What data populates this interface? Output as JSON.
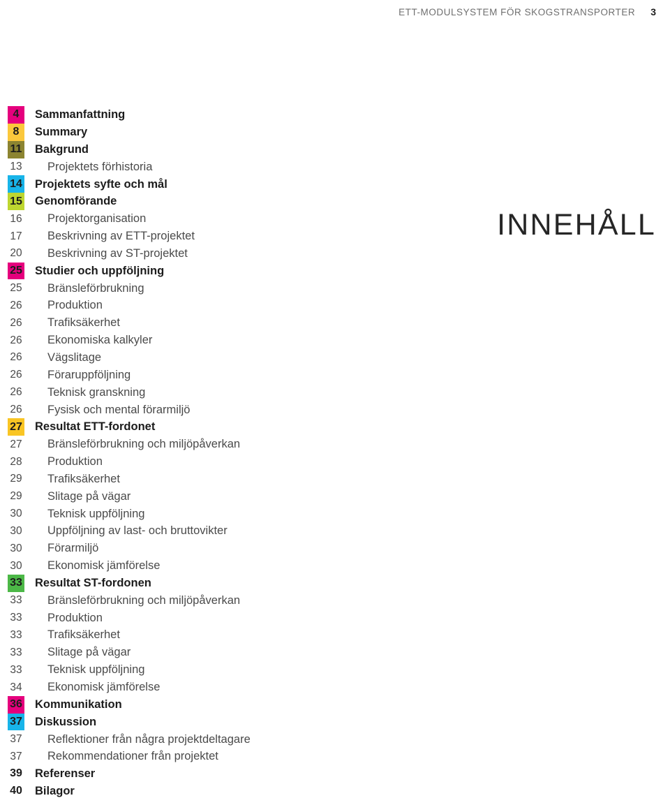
{
  "header": {
    "title": "ETT-MODULSYSTEM FÖR SKOGSTRANSPORTER",
    "folio": "3"
  },
  "section": {
    "title": "INNEHÅLL"
  },
  "colors": {
    "magenta": "#e5007d",
    "yellow": "#fbc83c",
    "olive": "#8c8431",
    "cyan": "#18b4e9",
    "lime": "#bed630",
    "gold": "#f9c524",
    "green": "#4cb847",
    "text_dark": "#1c1c1c",
    "text_gray": "#4a4a4a",
    "header_gray": "#6f6f6f"
  },
  "toc": {
    "items": [
      {
        "num": "4",
        "label": "Sammanfattning",
        "level": 1,
        "badge": "#e5007d"
      },
      {
        "num": "8",
        "label": "Summary",
        "level": 1,
        "badge": "#fbc83c"
      },
      {
        "num": "11",
        "label": "Bakgrund",
        "level": 1,
        "badge": "#8c8431"
      },
      {
        "num": "13",
        "label": "Projektets förhistoria",
        "level": 2,
        "badge": null
      },
      {
        "num": "14",
        "label": "Projektets syfte och mål",
        "level": 1,
        "badge": "#18b4e9"
      },
      {
        "num": "15",
        "label": "Genomförande",
        "level": 1,
        "badge": "#bed630"
      },
      {
        "num": "16",
        "label": "Projektorganisation",
        "level": 2,
        "badge": null
      },
      {
        "num": "17",
        "label": "Beskrivning av ETT-projektet",
        "level": 2,
        "badge": null
      },
      {
        "num": "20",
        "label": "Beskrivning av ST-projektet",
        "level": 2,
        "badge": null
      },
      {
        "num": "25",
        "label": "Studier och uppföljning",
        "level": 1,
        "badge": "#e5007d"
      },
      {
        "num": "25",
        "label": "Bränsleförbrukning",
        "level": 2,
        "badge": null
      },
      {
        "num": "26",
        "label": "Produktion",
        "level": 2,
        "badge": null
      },
      {
        "num": "26",
        "label": "Trafiksäkerhet",
        "level": 2,
        "badge": null
      },
      {
        "num": "26",
        "label": "Ekonomiska kalkyler",
        "level": 2,
        "badge": null
      },
      {
        "num": "26",
        "label": "Vägslitage",
        "level": 2,
        "badge": null
      },
      {
        "num": "26",
        "label": "Föraruppföljning",
        "level": 2,
        "badge": null
      },
      {
        "num": "26",
        "label": "Teknisk granskning",
        "level": 2,
        "badge": null
      },
      {
        "num": "26",
        "label": "Fysisk och mental förarmiljö",
        "level": 2,
        "badge": null
      },
      {
        "num": "27",
        "label": "Resultat ETT-fordonet",
        "level": 1,
        "badge": "#f9c524"
      },
      {
        "num": "27",
        "label": "Bränsleförbrukning och miljöpåverkan",
        "level": 2,
        "badge": null
      },
      {
        "num": "28",
        "label": "Produktion",
        "level": 2,
        "badge": null
      },
      {
        "num": "29",
        "label": "Trafiksäkerhet",
        "level": 2,
        "badge": null
      },
      {
        "num": "29",
        "label": "Slitage på vägar",
        "level": 2,
        "badge": null
      },
      {
        "num": "30",
        "label": "Teknisk uppföljning",
        "level": 2,
        "badge": null
      },
      {
        "num": "30",
        "label": "Uppföljning av last- och bruttovikter",
        "level": 2,
        "badge": null
      },
      {
        "num": "30",
        "label": "Förarmiljö",
        "level": 2,
        "badge": null
      },
      {
        "num": "30",
        "label": "Ekonomisk jämförelse",
        "level": 2,
        "badge": null
      },
      {
        "num": "33",
        "label": "Resultat ST-fordonen",
        "level": 1,
        "badge": "#4cb847"
      },
      {
        "num": "33",
        "label": "Bränsleförbrukning och miljöpåverkan",
        "level": 2,
        "badge": null
      },
      {
        "num": "33",
        "label": "Produktion",
        "level": 2,
        "badge": null
      },
      {
        "num": "33",
        "label": "Trafiksäkerhet",
        "level": 2,
        "badge": null
      },
      {
        "num": "33",
        "label": "Slitage på vägar",
        "level": 2,
        "badge": null
      },
      {
        "num": "33",
        "label": "Teknisk uppföljning",
        "level": 2,
        "badge": null
      },
      {
        "num": "34",
        "label": "Ekonomisk jämförelse",
        "level": 2,
        "badge": null
      },
      {
        "num": "36",
        "label": "Kommunikation",
        "level": 1,
        "badge": "#e5007d"
      },
      {
        "num": "37",
        "label": "Diskussion",
        "level": 1,
        "badge": "#18b4e9"
      },
      {
        "num": "37",
        "label": "Reflektioner från några projektdeltagare",
        "level": 2,
        "badge": null
      },
      {
        "num": "37",
        "label": "Rekommendationer från projektet",
        "level": 2,
        "badge": null
      },
      {
        "num": "39",
        "label": "Referenser",
        "level": 1,
        "badge": null
      },
      {
        "num": "40",
        "label": "Bilagor",
        "level": 1,
        "badge": null
      }
    ]
  }
}
